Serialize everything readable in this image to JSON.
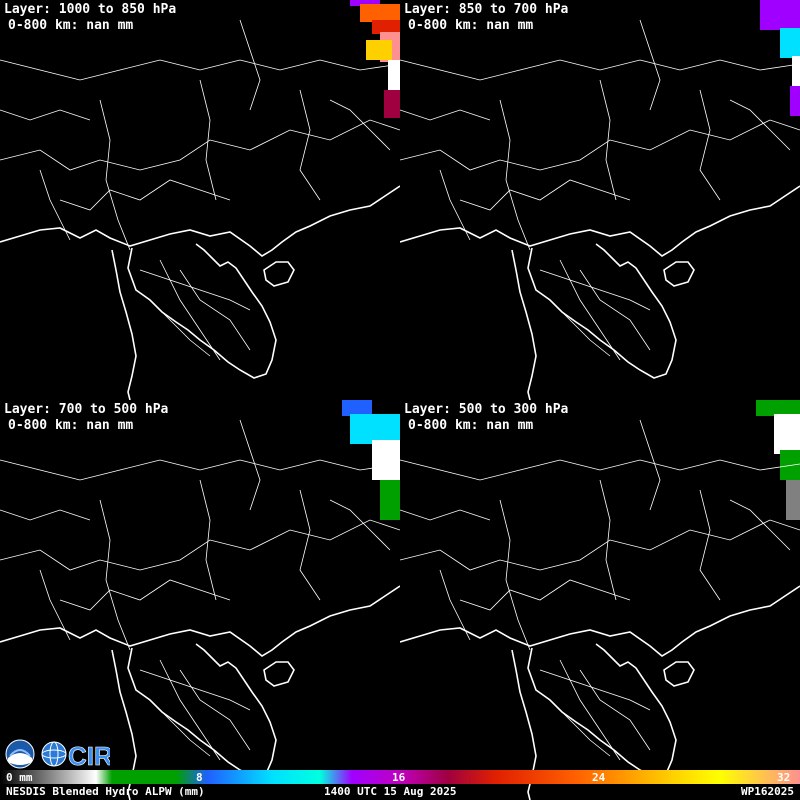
{
  "panels": [
    {
      "title": "Layer: 1000 to 850 hPa",
      "stat": "0-800 km: nan mm"
    },
    {
      "title": "Layer: 850 to 700 hPa",
      "stat": "0-800 km: nan mm"
    },
    {
      "title": "Layer: 700 to 500 hPa",
      "stat": "0-800 km: nan mm"
    },
    {
      "title": "Layer: 500 to 300 hPa",
      "stat": "0-800 km: nan mm"
    }
  ],
  "colorbar": {
    "unit": "mm",
    "ticks": [
      "0 mm",
      "8",
      "16",
      "24",
      "32"
    ],
    "tick_values": [
      0,
      8,
      16,
      24,
      32
    ],
    "range": [
      0,
      32
    ],
    "colors": [
      "#000000",
      "#ffffff",
      "#00a000",
      "#2060ff",
      "#00e0ff",
      "#a000ff",
      "#a00040",
      "#ff6000",
      "#ffff00",
      "#ff9090"
    ]
  },
  "footer": {
    "product": "NESDIS Blended Hydro ALPW (mm)",
    "time": "1400 UTC 15 Aug 2025",
    "storm_id": "WP162025"
  },
  "logos": [
    "noaa-logo",
    "cira-logo"
  ]
}
